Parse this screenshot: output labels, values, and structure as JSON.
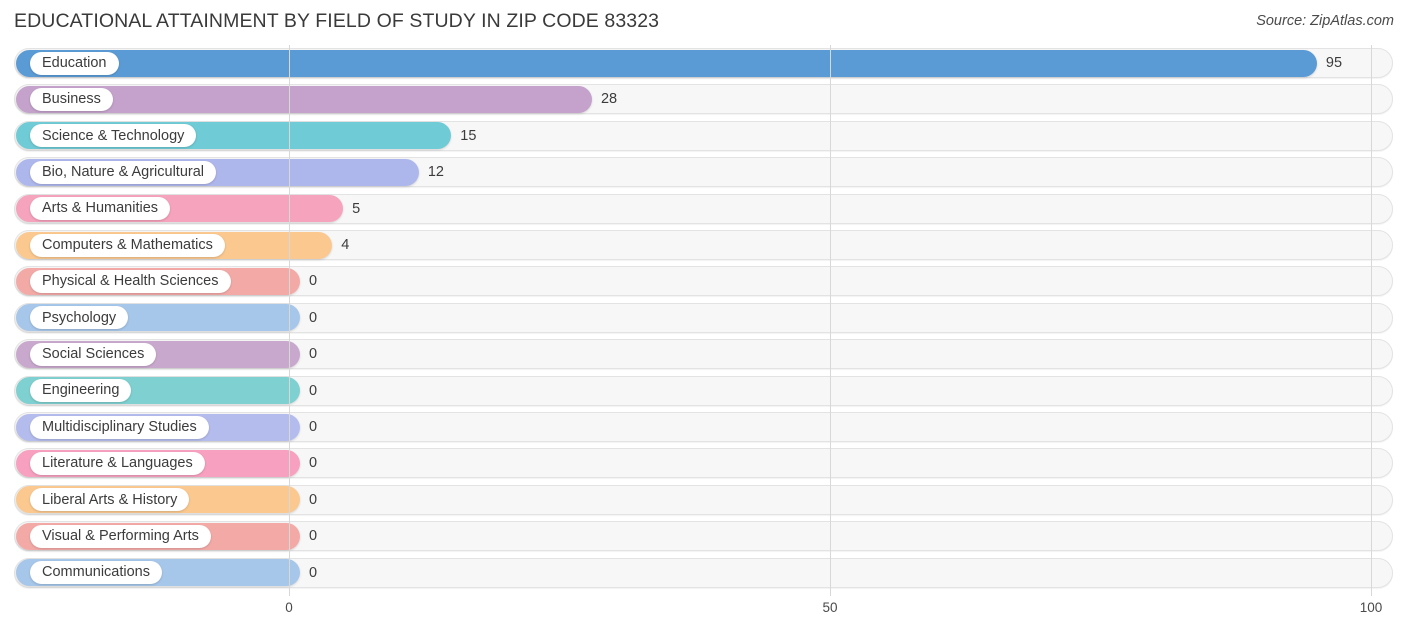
{
  "header": {
    "title": "EDUCATIONAL ATTAINMENT BY FIELD OF STUDY IN ZIP CODE 83323",
    "source": "Source: ZipAtlas.com"
  },
  "chart_data": {
    "type": "bar",
    "orientation": "horizontal",
    "title": "EDUCATIONAL ATTAINMENT BY FIELD OF STUDY IN ZIP CODE 83323",
    "xlabel": "",
    "ylabel": "",
    "xlim": [
      0,
      100
    ],
    "xticks": [
      "0",
      "50",
      "100"
    ],
    "xtick_values": [
      0,
      50,
      100
    ],
    "grid": true,
    "legend": false,
    "categories": [
      "Education",
      "Business",
      "Science & Technology",
      "Bio, Nature & Agricultural",
      "Arts & Humanities",
      "Computers & Mathematics",
      "Physical & Health Sciences",
      "Psychology",
      "Social Sciences",
      "Engineering",
      "Multidisciplinary Studies",
      "Literature & Languages",
      "Liberal Arts & History",
      "Visual & Performing Arts",
      "Communications"
    ],
    "values": [
      95,
      28,
      15,
      12,
      5,
      4,
      0,
      0,
      0,
      0,
      0,
      0,
      0,
      0,
      0
    ],
    "value_labels": [
      "95",
      "28",
      "15",
      "12",
      "5",
      "4",
      "0",
      "0",
      "0",
      "0",
      "0",
      "0",
      "0",
      "0",
      "0"
    ],
    "colors": [
      "#5b9bd5",
      "#c4a2cb",
      "#6fcbd5",
      "#aeb7ec",
      "#f6a3bd",
      "#fbc98f",
      "#f3aaa7",
      "#a6c6ea",
      "#c9a8cd",
      "#7fd0d0",
      "#b4bced",
      "#f7a0bf",
      "#fbc98f",
      "#f3aaa7",
      "#a6c6ea"
    ]
  },
  "style": {
    "track_color": "#f7f7f7",
    "track_border": "#e3e3e3",
    "grid_color": "#d8d8d8",
    "text_color": "#3c3c3c",
    "background": "#ffffff"
  }
}
